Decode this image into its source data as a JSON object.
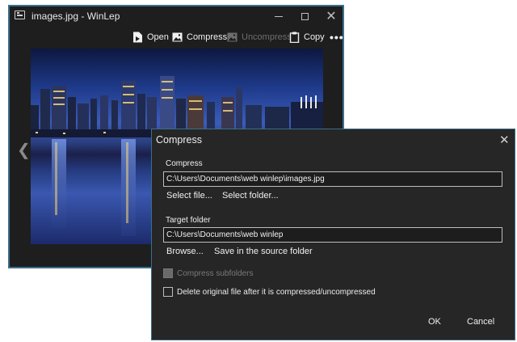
{
  "window": {
    "title": "images.jpg - WinLep",
    "toolbar": {
      "open": "Open",
      "compress": "Compress",
      "uncompress": "Uncompress",
      "copy": "Copy",
      "more": "•••"
    }
  },
  "dialog": {
    "title": "Compress",
    "compress_section": {
      "label": "Compress",
      "path": "C:\\Users\\Documents\\web winlep\\images.jpg",
      "select_file": "Select file...",
      "select_folder": "Select folder..."
    },
    "target_section": {
      "label": "Target folder",
      "path": "C:\\Users\\Documents\\web winlep",
      "browse": "Browse...",
      "save_in_source": "Save in the source folder"
    },
    "options": {
      "compress_subfolders": "Compress subfolders",
      "delete_original": "Delete original file after it is compressed/uncompressed"
    },
    "ok": "OK",
    "cancel": "Cancel"
  },
  "colors": {
    "accent_border": "#3a6e8a",
    "window_bg": "#1e1e1e",
    "dialog_bg": "#262626"
  }
}
